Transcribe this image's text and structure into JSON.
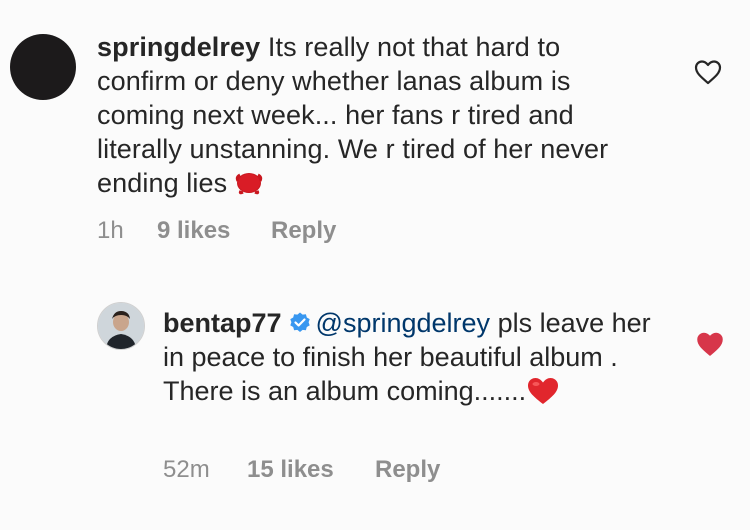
{
  "comments": [
    {
      "username": "springdelrey",
      "text": "Its really not that hard to confirm or deny whether lanas album is coming next week... her fans r tired and literally unstanning. We r tired of her never ending lies",
      "time": "1h",
      "likes": "9 likes",
      "reply_label": "Reply",
      "liked": false
    },
    {
      "username": "bentap77",
      "verified": true,
      "mention": "@springdelrey",
      "text": "pls leave her in peace to finish her beautiful album . There is an album coming.......",
      "time": "52m",
      "likes": "15 likes",
      "reply_label": "Reply",
      "liked": true
    }
  ],
  "colors": {
    "text": "#262626",
    "meta": "#8e8e8e",
    "mention": "#00376b",
    "liked_heart": "#d7364a",
    "verified": "#3897f0"
  },
  "icons": {
    "like_outline": "heart-outline-icon",
    "like_filled": "heart-filled-icon",
    "verified": "verified-badge-icon",
    "emoji_1": "angry-red-face-emoji",
    "emoji_2": "red-heart-emoji"
  }
}
